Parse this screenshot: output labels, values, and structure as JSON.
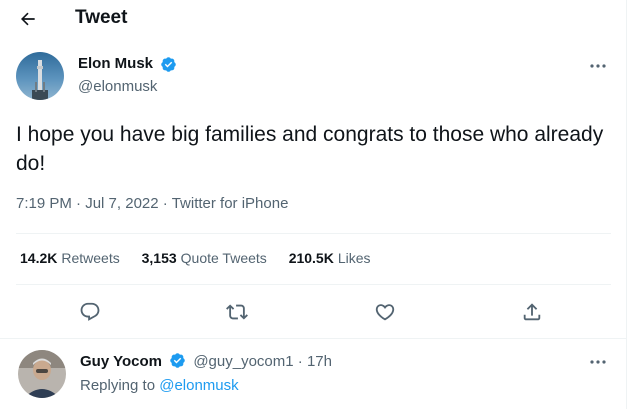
{
  "header": {
    "title": "Tweet",
    "back_icon": "arrow-left-icon"
  },
  "tweet": {
    "author_name": "Elon Musk",
    "author_handle": "@elonmusk",
    "text": "I hope you have big families and congrats to those who already do!",
    "time": "7:19 PM",
    "date": "Jul 7, 2022",
    "separator": "·",
    "source": "Twitter for iPhone",
    "stats": [
      {
        "count": "14.2K",
        "label": "Retweets"
      },
      {
        "count": "3,153",
        "label": "Quote Tweets"
      },
      {
        "count": "210.5K",
        "label": "Likes"
      }
    ],
    "actions": [
      "reply-icon",
      "retweet-icon",
      "like-icon",
      "share-icon"
    ]
  },
  "reply": {
    "author_name": "Guy Yocom",
    "author_handle": "@guy_yocom1",
    "separator": "·",
    "time": "17h",
    "replying_prefix": "Replying to",
    "replying_to": "@elonmusk"
  },
  "colors": {
    "text": "#0f1419",
    "secondary": "#536471",
    "accent": "#1d9bf0",
    "divider": "#eff3f4"
  }
}
